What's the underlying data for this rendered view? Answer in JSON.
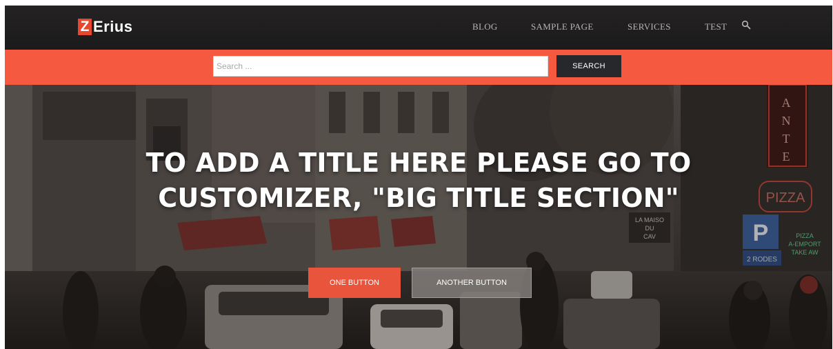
{
  "brand": {
    "logo_letter": "Z",
    "logo_text": "Erius",
    "accent_color": "#f55a40"
  },
  "nav": {
    "items": [
      {
        "label": "BLOG"
      },
      {
        "label": "SAMPLE PAGE"
      },
      {
        "label": "SERVICES"
      },
      {
        "label": "TEST"
      }
    ],
    "search_icon": "search-icon"
  },
  "search": {
    "placeholder": "Search ...",
    "value": "",
    "button_label": "SEARCH"
  },
  "hero": {
    "title_line1": "TO ADD A TITLE HERE PLEASE GO TO",
    "title_line2": "CUSTOMIZER, \"BIG TITLE SECTION\"",
    "button_primary": "ONE BUTTON",
    "button_secondary": "ANOTHER BUTTON",
    "signs": {
      "sign_ante": "ANTE",
      "sign_pizza": "PIZZA",
      "sign_parking": "P",
      "sign_maison": "LA MAISO\nDU\nCAV",
      "sign_rodes": "2 RODES",
      "sign_green": "PIZZA\nA-EMPORT\nTAKE AW"
    }
  }
}
